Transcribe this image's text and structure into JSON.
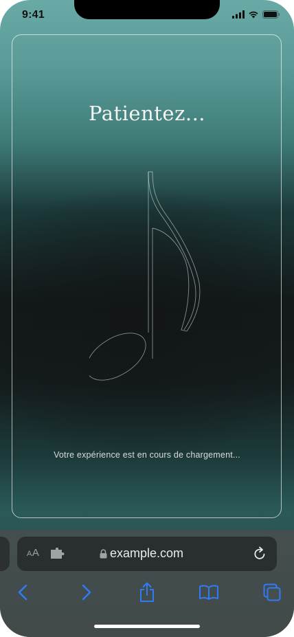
{
  "status_bar": {
    "time": "9:41",
    "icons": [
      "signal-icon",
      "wifi-icon",
      "battery-icon"
    ]
  },
  "content": {
    "title": "Patientez...",
    "loading_text": "Votre expérience est en cours de chargement...",
    "illustration": "music-note-icon"
  },
  "browser": {
    "text_size_label_small": "A",
    "text_size_label_large": "A",
    "url": "example.com",
    "accent_color": "#2f7cf6",
    "toolbar_icons": [
      "back-icon",
      "forward-icon",
      "share-icon",
      "bookmarks-icon",
      "tabs-icon"
    ]
  }
}
